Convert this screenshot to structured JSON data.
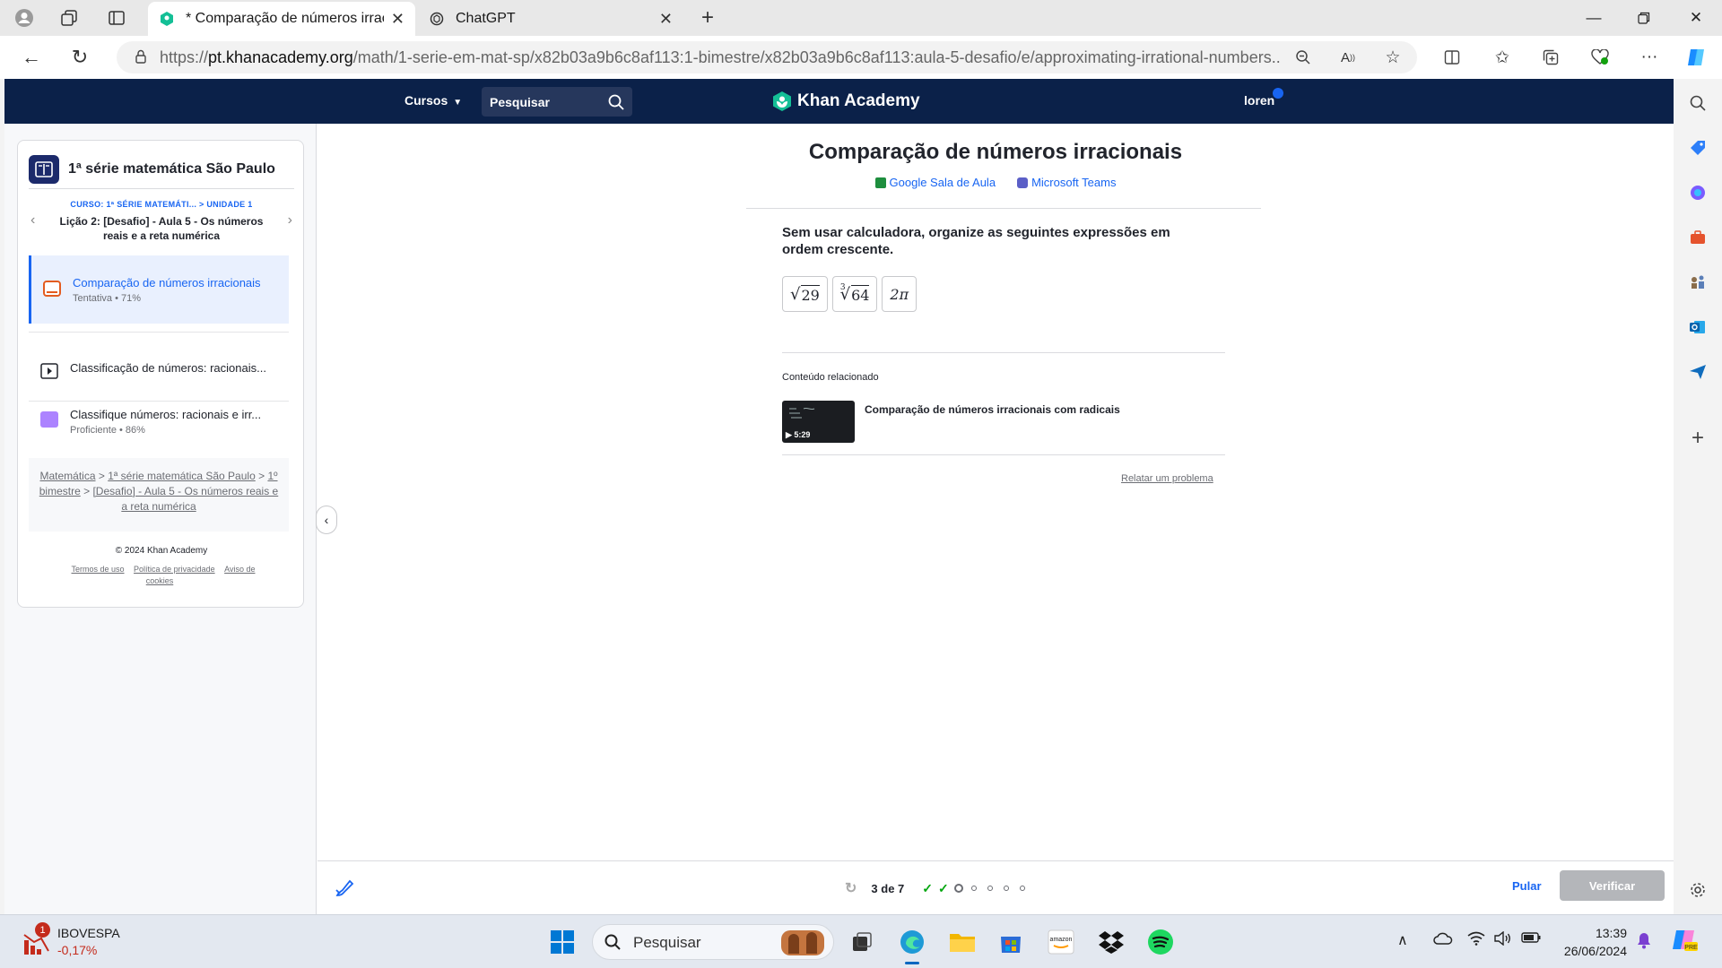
{
  "browser": {
    "tabs": [
      {
        "title": "* Comparação de números irracionais",
        "active": true
      },
      {
        "title": "ChatGPT",
        "active": false
      }
    ],
    "url_prefix": "https://",
    "url_host": "pt.khanacademy.org",
    "url_path": "/math/1-serie-em-mat-sp/x82b03a9b6c8af113:1-bimestre/x82b03a9b6c8af113:aula-5-desafio/e/approximating-irrational-numbers..."
  },
  "header": {
    "cursos": "Cursos",
    "search_placeholder": "Pesquisar",
    "logo": "Khan Academy",
    "user": "loren"
  },
  "sidebar": {
    "course_title": "1ª série matemática São Paulo",
    "crumb_course": "CURSO: 1ª SÉRIE MATEMÁTI...",
    "crumb_sep": ">",
    "crumb_unit": "UNIDADE 1",
    "lesson_title": "Lição 2: [Desafio] - Aula 5 - Os números reais e a reta numérica",
    "items": [
      {
        "title": "Comparação de números irracionais",
        "sub": "Tentativa • 71%"
      },
      {
        "title": "Classificação de números: racionais..."
      },
      {
        "title": "Classifique números: racionais e irr...",
        "sub": "Proficiente • 86%"
      }
    ],
    "breadcrumbs": {
      "b1": "Matemática",
      "b2": "1ª série matemática São Paulo",
      "b3": "1º bimestre",
      "b4": "[Desafio] - Aula 5 - Os números reais e a reta numérica",
      "sep": ">"
    },
    "copyright": "© 2024 Khan Academy",
    "links": [
      "Termos de uso",
      "Política de privacidade",
      "Aviso de cookies"
    ]
  },
  "exercise": {
    "title": "Comparação de números irracionais",
    "share_google": "Google Sala de Aula",
    "share_teams": "Microsoft Teams",
    "question": "Sem usar calculadora, organize as seguintes expressões em ordem crescente.",
    "options": [
      {
        "radicand": "29"
      },
      {
        "index": "3",
        "radicand": "64"
      },
      {
        "text": "2π"
      }
    ],
    "related_title": "Conteúdo relacionado",
    "related_video_title": "Comparação de números irracionais com radicais",
    "related_video_duration": "5:29",
    "report": "Relatar um problema"
  },
  "footer": {
    "progress_text": "3 de 7",
    "completed": 2,
    "total": 7,
    "skip": "Pular",
    "check": "Verificar"
  },
  "taskbar": {
    "ticker_badge": "1",
    "ticker_name": "IBOVESPA",
    "ticker_change": "-0,17%",
    "search_placeholder": "Pesquisar",
    "time": "13:39",
    "date": "26/06/2024"
  },
  "colors": {
    "ka_navy": "#0b2149",
    "ka_blue": "#1865f2",
    "check_green": "#00a60e"
  }
}
